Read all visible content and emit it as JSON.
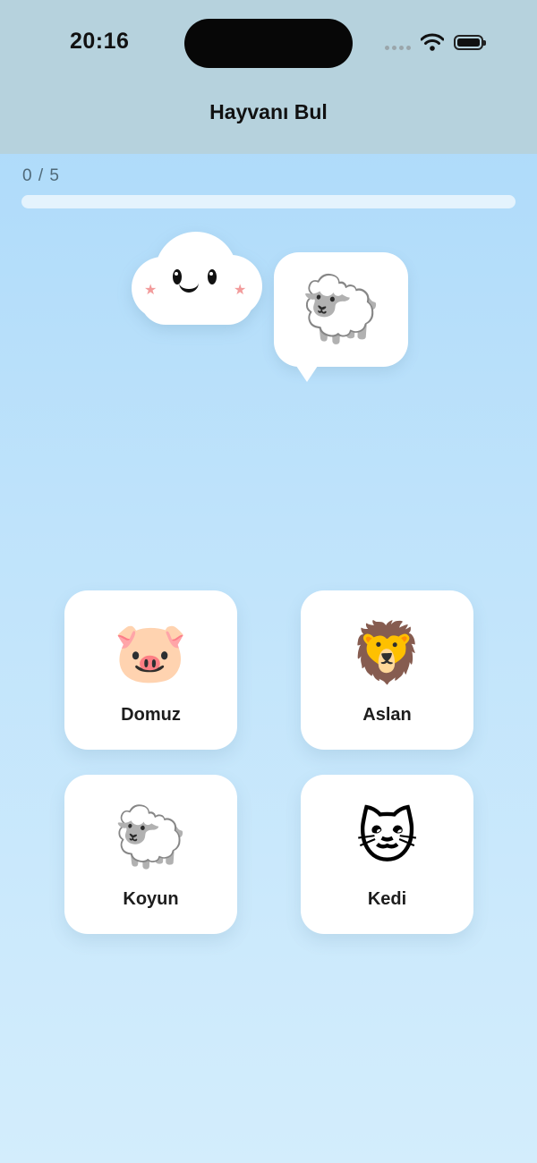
{
  "status_bar": {
    "time": "20:16",
    "icons": [
      "cellular-signal-icon",
      "wifi-icon",
      "battery-icon"
    ]
  },
  "nav": {
    "title": "Hayvanı Bul"
  },
  "progress": {
    "text": "0 / 5",
    "current": 0,
    "total": 5,
    "fraction": 0
  },
  "mascot": {
    "icon": "smiling-cloud-icon"
  },
  "prompt": {
    "emoji": "🐑"
  },
  "options": [
    {
      "emoji": "🐷",
      "label": "Domuz"
    },
    {
      "emoji": "🦁",
      "label": "Aslan"
    },
    {
      "emoji": "🐑",
      "label": "Koyun"
    },
    {
      "emoji": "🐱",
      "label": "Kedi"
    }
  ],
  "colors": {
    "header_bg": "#b6d2dd",
    "background_top": "#a9d8f9",
    "background_bottom": "#d3edfc",
    "card": "#ffffff",
    "progress_track": "#e6f3fc",
    "progress_text": "#4f6978"
  }
}
